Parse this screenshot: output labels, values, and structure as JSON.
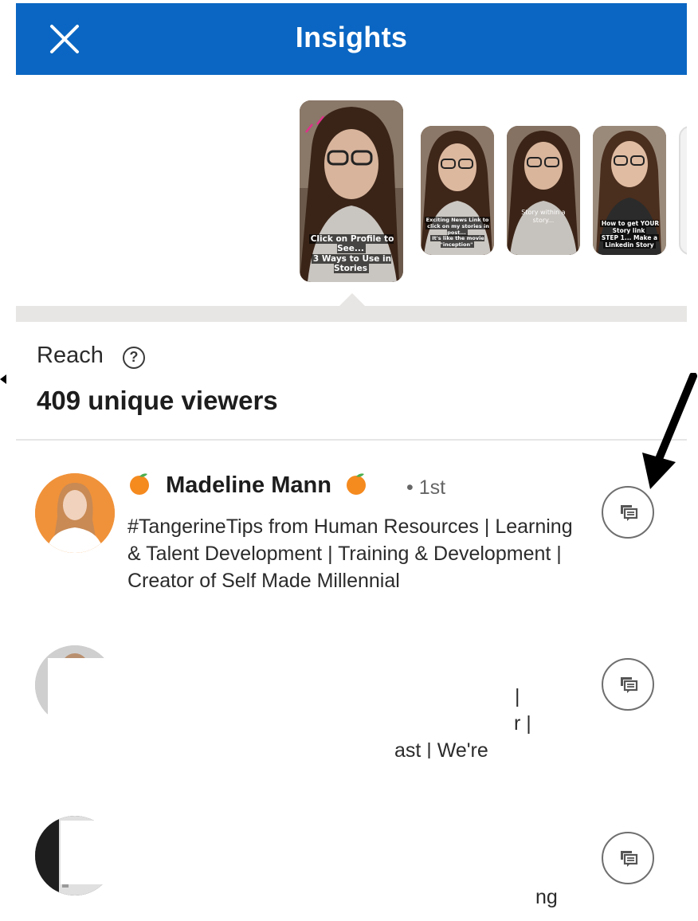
{
  "header": {
    "title": "Insights",
    "close_icon": "close-icon"
  },
  "stories": [
    {
      "caption_lines": [
        "Click on Profile to See...",
        "3 Ways to Use in Stories"
      ],
      "selected": true
    },
    {
      "caption_lines": [
        "Exciting News Link to",
        "click on my stories in post...",
        "It's like the movie \"inception\""
      ],
      "selected": false
    },
    {
      "caption_lines": [
        "Story within a story..."
      ],
      "selected": false
    },
    {
      "caption_lines": [
        "How to get YOUR Story link",
        "STEP 1... Make a",
        "Linkedin Story"
      ],
      "selected": false
    }
  ],
  "reach": {
    "label": "Reach",
    "value": "409 unique viewers"
  },
  "viewers": [
    {
      "name": "Madeline Mann",
      "degree": "• 1st",
      "headline": "#TangerineTips from Human Resources | Learning & Talent Development | Training & Development | Creator of Self Made Millennial"
    },
    {
      "fragments": [
        "|",
        "r |",
        "ast | We're"
      ]
    },
    {
      "fragments": [
        "ng"
      ]
    }
  ],
  "colors": {
    "brand": "#0a66c2",
    "track": "#e7e6e4"
  }
}
